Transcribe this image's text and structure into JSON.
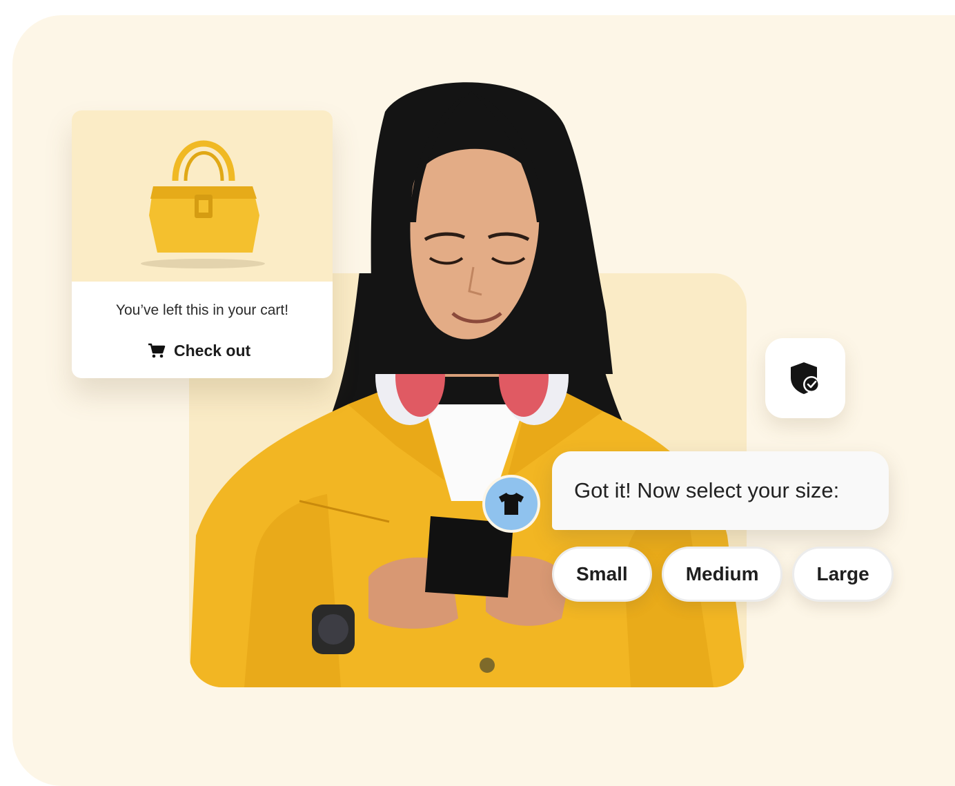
{
  "cart_card": {
    "message": "You’ve left this in your cart!",
    "checkout_label": "Check out",
    "product_icon": "handbag",
    "checkout_icon": "cart-icon"
  },
  "security_badge": {
    "icon": "shield-check-icon"
  },
  "chat": {
    "avatar_icon": "tshirt-icon",
    "message": "Got it! Now select your size:",
    "size_options": [
      "Small",
      "Medium",
      "Large"
    ]
  },
  "colors": {
    "background": "#fdf6e7",
    "panel": "#faebc6",
    "jacket_yellow": "#f2b623",
    "avatar_blue": "#8fc2ee"
  }
}
